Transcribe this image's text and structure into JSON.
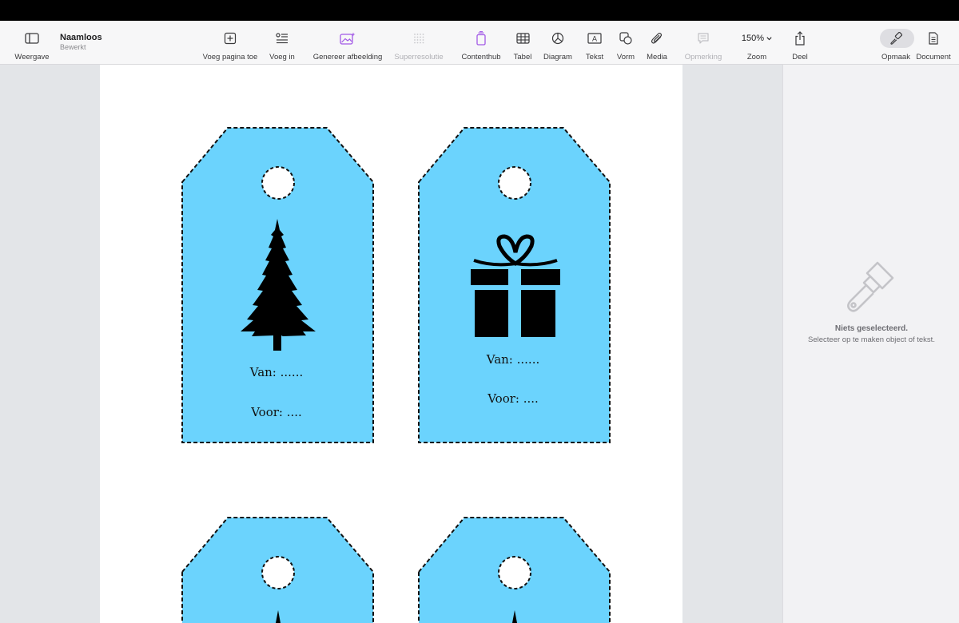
{
  "document": {
    "title": "Naamloos",
    "status": "Bewerkt"
  },
  "toolbar": {
    "view_label": "Weergave",
    "add_page_label": "Voeg pagina toe",
    "insert_label": "Voeg in",
    "generate_image_label": "Genereer afbeelding",
    "superresolution_label": "Superresolutie",
    "contenthub_label": "Contenthub",
    "table_label": "Tabel",
    "chart_label": "Diagram",
    "text_label": "Tekst",
    "shape_label": "Vorm",
    "media_label": "Media",
    "comment_label": "Opmerking",
    "zoom_value": "150%",
    "zoom_label": "Zoom",
    "share_label": "Deel",
    "format_label": "Opmaak",
    "document_label": "Document"
  },
  "inspector": {
    "empty_title": "Niets geselecteerd.",
    "empty_hint": "Selecteer op te maken object of tekst."
  },
  "tags": [
    {
      "icon": "christmas-tree-icon",
      "from_text": "Van: ......",
      "to_text": "Voor: ...."
    },
    {
      "icon": "gift-icon",
      "from_text": "Van: ......",
      "to_text": "Voor: ...."
    }
  ],
  "colors": {
    "tag_fill": "#6bd3fd",
    "accent_purple": "#a259e6",
    "toolbar_bg": "#f7f7f8",
    "canvas_bg": "#e3e5e8",
    "inspector_bg": "#f2f2f4"
  }
}
